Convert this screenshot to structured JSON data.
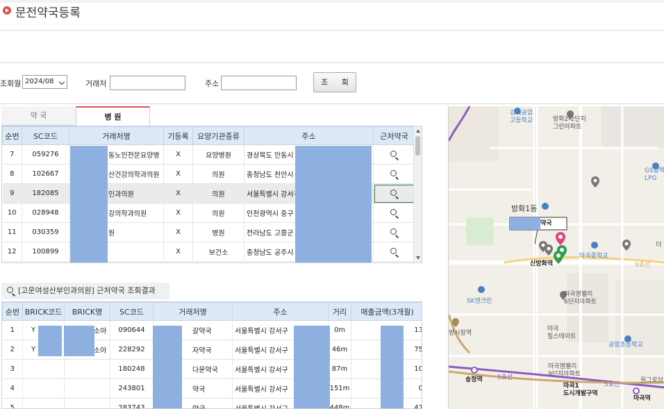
{
  "page": {
    "title": "문전약국등록"
  },
  "filters": {
    "month_label": "조회월",
    "month_value": "2024/08",
    "client_label": "거래처",
    "client_value": "",
    "address_label": "주소",
    "address_value": "",
    "search_button": "조 회"
  },
  "tabs": [
    {
      "label": "약 국",
      "active": false
    },
    {
      "label": "병 원",
      "active": true
    }
  ],
  "upper_grid": {
    "columns": [
      "순번",
      "SC코드",
      "거래처명",
      "기등록",
      "요양기관종류",
      "주소",
      "근처약국"
    ],
    "rows": [
      {
        "no": "7",
        "sc": "059276",
        "name": "동노인전문요양병",
        "reg": "X",
        "type": "요양병원",
        "addr": "경상북도 안동시"
      },
      {
        "no": "8",
        "sc": "102667",
        "name": "산건강의학과의원",
        "reg": "X",
        "type": "의원",
        "addr": "충청남도 천안시"
      },
      {
        "no": "9",
        "sc": "182085",
        "name": "인과의원",
        "reg": "X",
        "type": "의원",
        "addr": "서울특별시 강서구"
      },
      {
        "no": "10",
        "sc": "028948",
        "name": "강의학과의원",
        "reg": "X",
        "type": "의원",
        "addr": "인천광역시 중구"
      },
      {
        "no": "11",
        "sc": "030359",
        "name": "원",
        "reg": "X",
        "type": "병원",
        "addr": "전라남도 고흥군"
      },
      {
        "no": "12",
        "sc": "100899",
        "name": "",
        "reg": "X",
        "type": "보건소",
        "addr": "충청남도 공주시"
      }
    ]
  },
  "result": {
    "header": "[고운여성산부인과의원] 근처약국 조회결과"
  },
  "lower_grid": {
    "columns": [
      "순번",
      "BRICK코드",
      "BRICK명",
      "SC코드",
      "거래처명",
      "주소",
      "거리",
      "매출금액(3개월)"
    ],
    "rows": [
      {
        "no": "1",
        "brick_code": "Y",
        "brick_name": "소아",
        "sc": "090644",
        "name": "갈약국",
        "addr": "서울특별시 강서구",
        "dist": "0m",
        "sales": "13"
      },
      {
        "no": "2",
        "brick_code": "Y",
        "brick_name": "소아",
        "sc": "228292",
        "name": "자약국",
        "addr": "서울특별시 강서구",
        "dist": "46m",
        "sales": "75"
      },
      {
        "no": "3",
        "brick_code": "",
        "brick_name": "",
        "sc": "180248",
        "name": "다운약국",
        "addr": "서울특별시 강서구",
        "dist": "87m",
        "sales": "10"
      },
      {
        "no": "4",
        "brick_code": "",
        "brick_name": "",
        "sc": "243801",
        "name": "약국",
        "addr": "서울특별시 강서구",
        "dist": "151m",
        "sales": "0"
      },
      {
        "no": "5",
        "brick_code": "",
        "brick_name": "",
        "sc": "283743",
        "name": "약국",
        "addr": "서울특별시 강서구",
        "dist": "448m",
        "sales": "47"
      }
    ]
  },
  "map": {
    "labels": {
      "school1": "강서공업\n고등학교",
      "apt1": "방화2-2단지\n그린아파트",
      "gs": "GS칼텍\nLPG",
      "banghwa": "방화1동",
      "pharm": "약국",
      "sinbang": "신방화역",
      "magok_mid": "마곡중학교",
      "mae": "더",
      "sk": "SK엔크린",
      "valley6": "마곡엠밸리\n6단지아파트",
      "hills": "마곡\n힐스테이트",
      "airport_el": "공항초등학교",
      "gangseo": "방시장역",
      "valley9": "마곡엠밸리\n9단지아파트",
      "songjeong": "송정역",
      "line5a": "5호선",
      "line9": "9호선",
      "line5b": "5호선",
      "magok1": "마곡1\n도시개발구역",
      "magokyeok": "마곡역",
      "wongreen": "원그로브"
    },
    "colors": {
      "pin_pink": "#e0457b",
      "pin_green": "#2e9e4f",
      "line5": "#8a5cc2",
      "line9": "#c9a96e"
    }
  }
}
